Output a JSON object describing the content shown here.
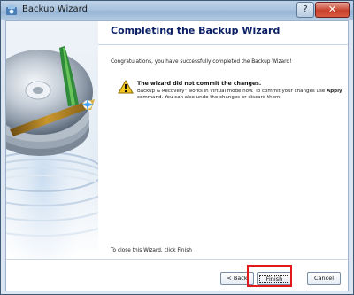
{
  "window": {
    "title": "Backup Wizard",
    "help_label": "?",
    "close_label": "✕"
  },
  "content": {
    "heading": "Completing the Backup Wizard",
    "congrats": "Congratulations, you have successfully completed the Backup Wizard!",
    "warning_title": "The wizard did not commit the changes.",
    "warning_part1": "Backup & Recovery\" works in virtual mode now. To commit your changes use ",
    "warning_bold": "Apply",
    "warning_part2": " command. You can also undo the changes or discard them.",
    "close_hint": "To close this Wizard, click Finish"
  },
  "buttons": {
    "back": "< Back",
    "finish": "Finish",
    "cancel": "Cancel"
  },
  "colors": {
    "heading": "#0a1f64",
    "highlight": "#e2191b",
    "warning": "#f3c623"
  }
}
